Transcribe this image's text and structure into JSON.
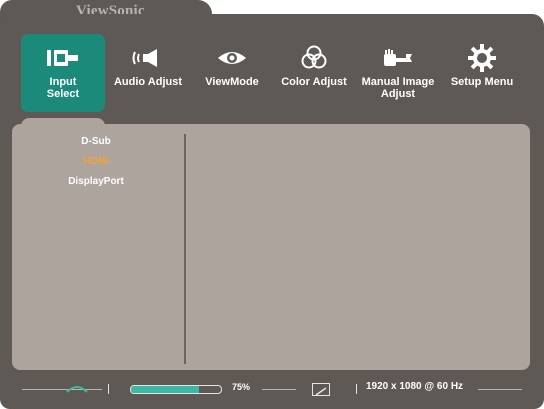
{
  "brand": "ViewSonic",
  "menu": [
    {
      "label": "Input\nSelect",
      "icon": "input-select-icon",
      "active": true
    },
    {
      "label": "Audio Adjust",
      "icon": "speaker-icon",
      "active": false
    },
    {
      "label": "ViewMode",
      "icon": "eye-icon",
      "active": false
    },
    {
      "label": "Color Adjust",
      "icon": "color-circles-icon",
      "active": false
    },
    {
      "label": "Manual Image\nAdjust",
      "icon": "hand-wrench-icon",
      "active": false
    },
    {
      "label": "Setup Menu",
      "icon": "gear-icon",
      "active": false
    }
  ],
  "inputs": [
    {
      "label": "D-Sub",
      "selected": false
    },
    {
      "label": "HDMI",
      "selected": true
    },
    {
      "label": "DisplayPort",
      "selected": false
    }
  ],
  "status": {
    "progress_percent": 75,
    "progress_label": "75%",
    "resolution": "1920 x 1080 @ 60 Hz"
  },
  "colors": {
    "accent": "#1b8a7b",
    "selected_text": "#f2a33a",
    "frame": "#5e5955",
    "panel": "#ada49e"
  }
}
